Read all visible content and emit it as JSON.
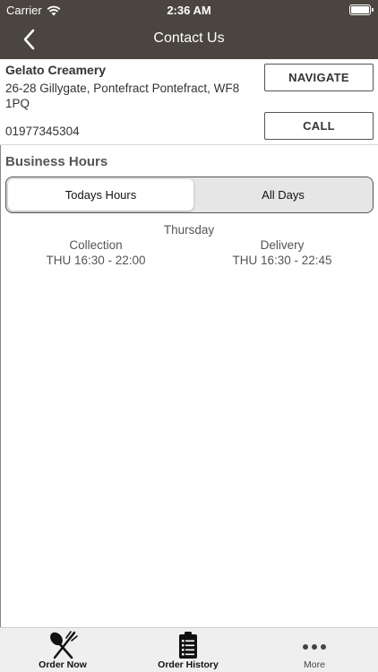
{
  "status_bar": {
    "carrier": "Carrier",
    "time": "2:36 AM"
  },
  "nav": {
    "title": "Contact Us"
  },
  "shop": {
    "name": "Gelato Creamery",
    "address": "26-28 Gillygate, Pontefract Pontefract, WF8 1PQ",
    "phone": "01977345304",
    "navigate_label": "NAVIGATE",
    "call_label": "CALL"
  },
  "hours": {
    "section_title": "Business Hours",
    "tabs": [
      {
        "label": "Todays Hours",
        "selected": true
      },
      {
        "label": "All Days",
        "selected": false
      }
    ],
    "day": "Thursday",
    "collection": {
      "label": "Collection",
      "time": "THU 16:30 - 22:00"
    },
    "delivery": {
      "label": "Delivery",
      "time": "THU 16:30 - 22:45"
    }
  },
  "tab_bar": {
    "items": [
      {
        "label": "Order Now",
        "icon": "fork-knife-icon"
      },
      {
        "label": "Order History",
        "icon": "clipboard-list-icon"
      },
      {
        "label": "More",
        "icon": "more-dots-icon"
      }
    ]
  },
  "colors": {
    "header_bg": "#4a453f",
    "tab_bar_bg": "#efefef"
  }
}
